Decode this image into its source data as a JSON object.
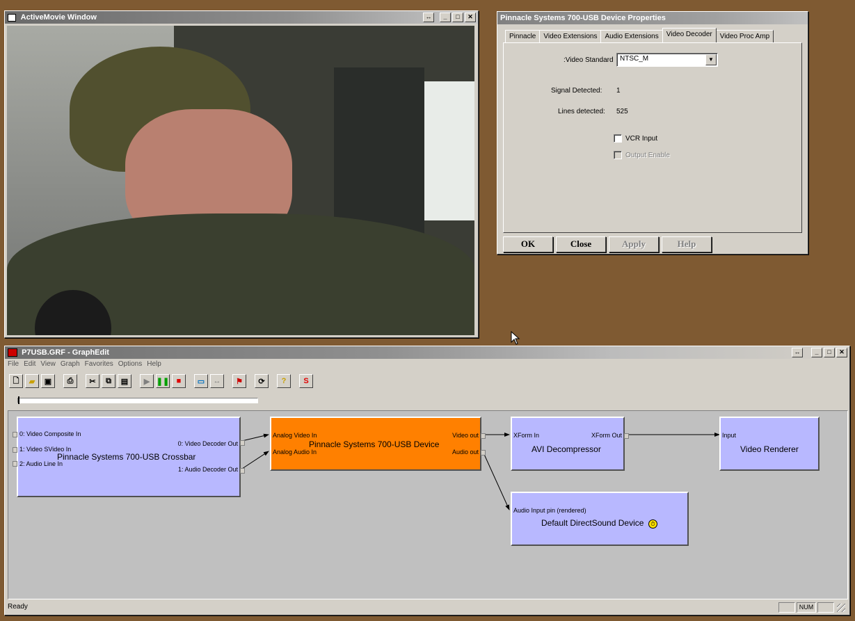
{
  "activemovie": {
    "title": "ActiveMovie Window"
  },
  "props": {
    "title": "Pinnacle Systems 700-USB Device Properties",
    "tabs": [
      "Pinnacle",
      "Video Extensions",
      "Audio Extensions",
      "Video Decoder",
      "Video Proc Amp"
    ],
    "video_standard_label": ":Video Standard",
    "video_standard_value": "NTSC_M",
    "signal_label": "Signal Detected:",
    "signal_value": "1",
    "lines_label": "Lines detected:",
    "lines_value": "525",
    "vcr_label": "VCR Input",
    "output_enable_label": "Output Enable",
    "buttons": {
      "ok": "OK",
      "close": "Close",
      "apply": "Apply",
      "help": "Help"
    }
  },
  "graphedit": {
    "title": "P7USB.GRF - GraphEdit",
    "menu": [
      "File",
      "Edit",
      "View",
      "Graph",
      "Favorites",
      "Options",
      "Help"
    ],
    "status": "Ready",
    "num_indicator": "NUM",
    "stop_glyph": "S",
    "filters": {
      "crossbar": {
        "name": "Pinnacle Systems 700-USB Crossbar",
        "in0": "0: Video Composite In",
        "in1": "1: Video SVideo In",
        "in2": "2: Audio Line In",
        "out0": "0: Video Decoder Out",
        "out1": "1: Audio Decoder Out"
      },
      "device": {
        "name": "Pinnacle Systems 700-USB Device",
        "in0": "Analog Video In",
        "in1": "Analog Audio In",
        "out0": "Video out",
        "out1": "Audio out"
      },
      "avi": {
        "name": "AVI Decompressor",
        "in0": "XForm In",
        "out0": "XForm Out"
      },
      "renderer": {
        "name": "Video Renderer",
        "in0": "Input"
      },
      "dsound": {
        "name": "Default DirectSound Device",
        "in0": "Audio Input pin (rendered)"
      }
    }
  },
  "colors": {
    "desktop": "#7f5a32",
    "filter": "#b8b8ff",
    "capture_filter": "#ff8000"
  }
}
